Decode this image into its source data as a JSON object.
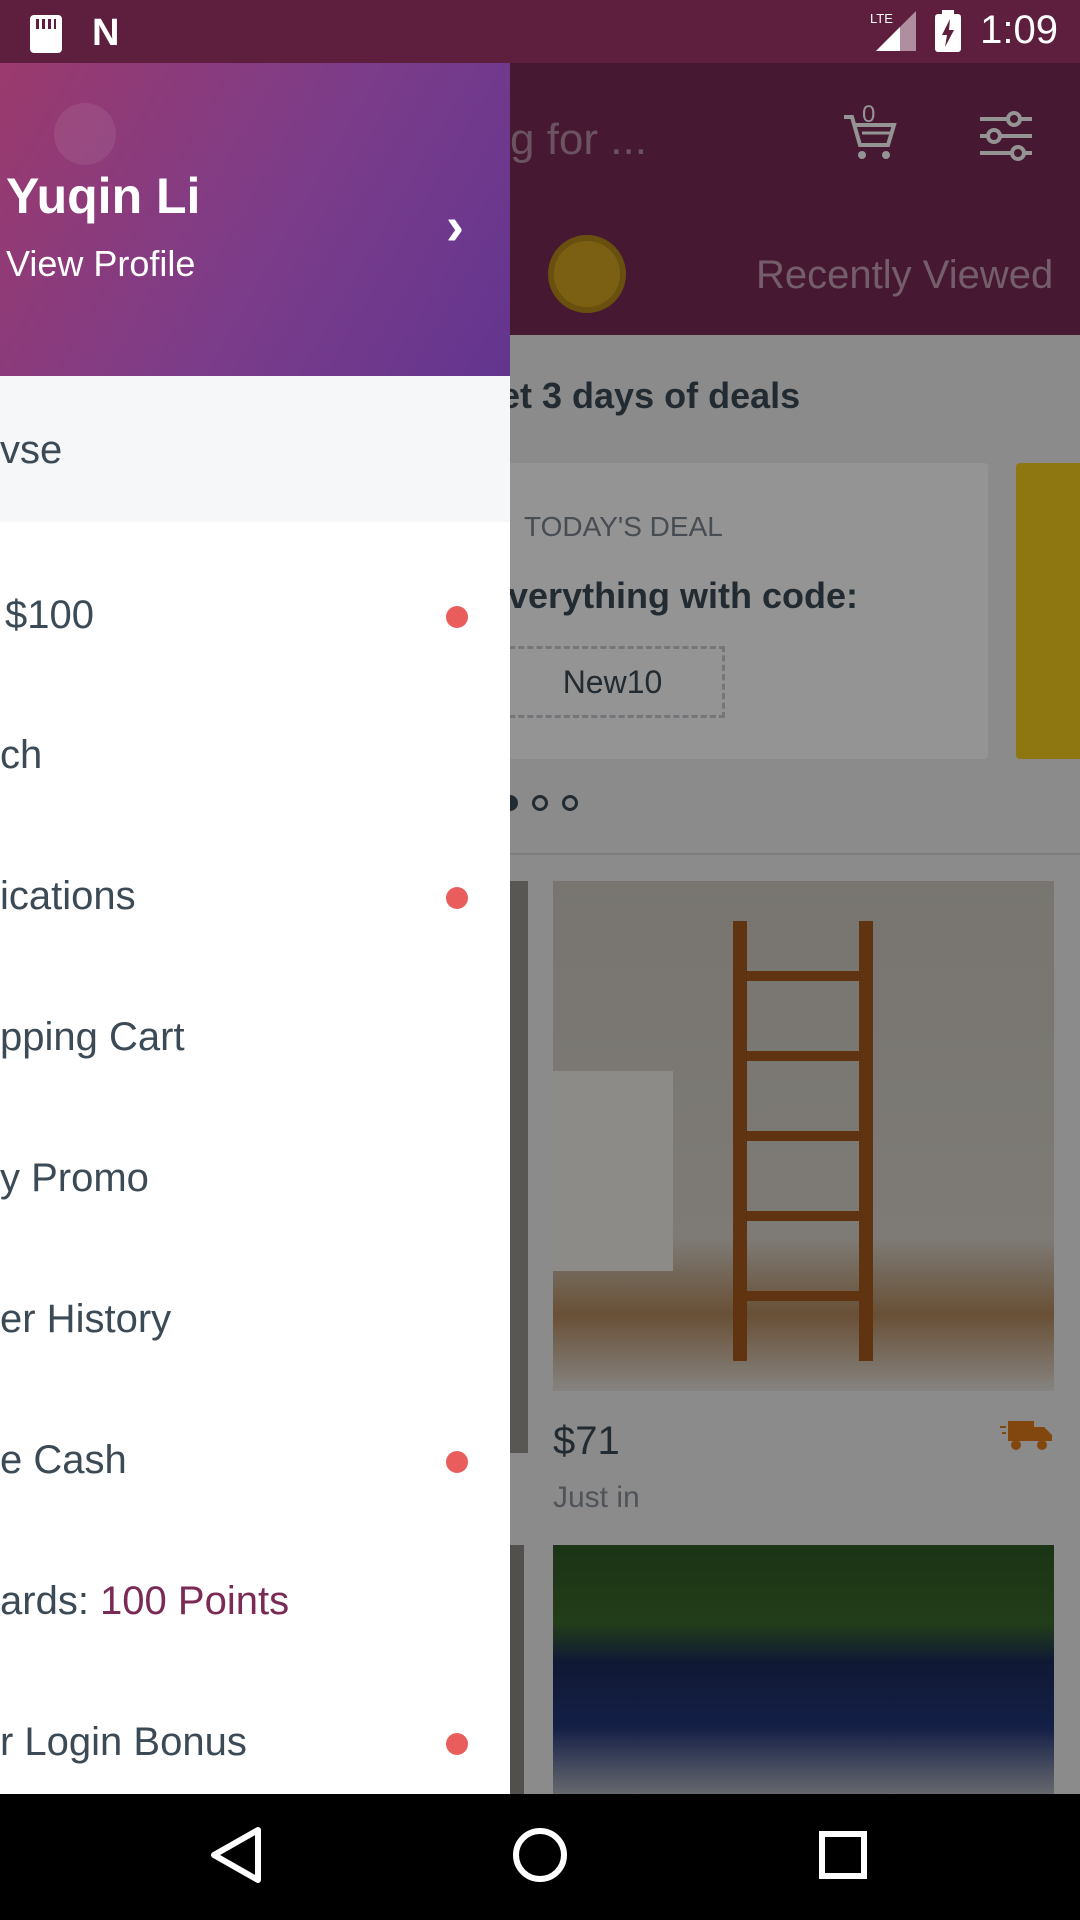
{
  "status_bar": {
    "time": "1:09",
    "network": "LTE",
    "icons": [
      "sd-card-icon",
      "n-notification-icon",
      "signal-icon",
      "battery-charging-icon"
    ]
  },
  "app": {
    "search_placeholder": "g for ...",
    "cart_count": "0",
    "recently_viewed": "Recently Viewed",
    "deals_title": "et 3 days of deals",
    "deal_label": "TODAY'S DEAL",
    "deal_text": "verything with code:",
    "deal_code": "New10",
    "product": {
      "price": "$71",
      "status": "Just in"
    }
  },
  "drawer": {
    "user_name": "Yuqin Li",
    "view_profile": "View Profile",
    "items": [
      {
        "label": "vse",
        "dot": false
      },
      {
        "label": "$100",
        "dot": true
      },
      {
        "label": "ch",
        "dot": false
      },
      {
        "label": "ications",
        "dot": true
      },
      {
        "label": "pping Cart",
        "dot": false
      },
      {
        "label": "y Promo",
        "dot": false
      },
      {
        "label": "er History",
        "dot": false
      },
      {
        "label": "e Cash",
        "dot": true
      },
      {
        "label": "ards: ",
        "accent": "100 Points",
        "dot": false
      },
      {
        "label": "r Login Bonus",
        "dot": true
      }
    ]
  },
  "colors": {
    "brand": "#7a2a55",
    "status_bar": "#5e1f3e",
    "notification_dot": "#e95d5d",
    "text": "#3c4a56"
  }
}
